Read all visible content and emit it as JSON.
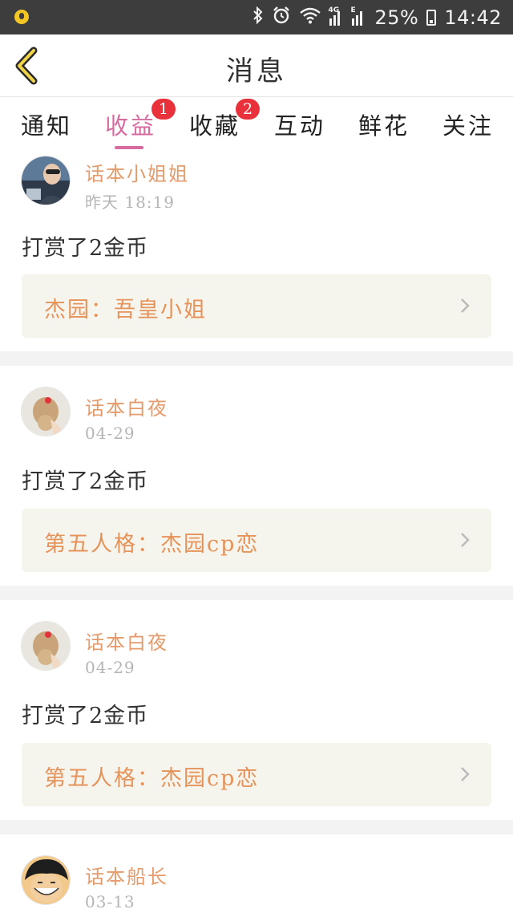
{
  "status_bar": {
    "notification_icon": "notification-icon",
    "icons": [
      "bluetooth-icon",
      "alarm-icon",
      "wifi-icon"
    ],
    "signal_tags": [
      "4G",
      "E"
    ],
    "battery_percent": "25%",
    "time": "14:42"
  },
  "header": {
    "back_icon": "chevron-left-icon",
    "title": "消息"
  },
  "tabs": [
    {
      "label": "通知"
    },
    {
      "label": "收益",
      "active": true,
      "badge": "1"
    },
    {
      "label": "收藏",
      "badge": "2"
    },
    {
      "label": "互动"
    },
    {
      "label": "鲜花"
    },
    {
      "label": "关注"
    }
  ],
  "messages": [
    {
      "user": "话本小姐姐",
      "time": "昨天 18:19",
      "text": "打赏了2金币",
      "card": "杰园：吾皇小姐"
    },
    {
      "user": "话本白夜",
      "time": "04-29",
      "text": "打赏了2金币",
      "card": "第五人格：杰园cp恋"
    },
    {
      "user": "话本白夜",
      "time": "04-29",
      "text": "打赏了2金币",
      "card": "第五人格：杰园cp恋"
    },
    {
      "user": "话本船长",
      "time": "03-13"
    }
  ],
  "colors": {
    "accent_pink": "#d66ba0",
    "username_orange": "#e59b6b",
    "card_text_orange": "#e6935a",
    "badge_red": "#e8313a",
    "card_bg": "#f5f4ed"
  }
}
